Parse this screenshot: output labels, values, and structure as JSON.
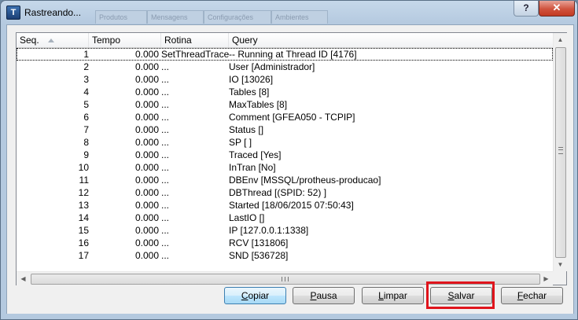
{
  "window": {
    "title": "Rastreando...",
    "help_label": "?",
    "close_label": "✕"
  },
  "ghost_tabs": [
    "Produtos",
    "Mensagens",
    "Configurações",
    "Ambientes"
  ],
  "columns": {
    "seq": "Seq.",
    "tempo": "Tempo",
    "rotina": "Rotina",
    "query": "Query"
  },
  "rows": [
    {
      "seq": "1",
      "tempo": "0.000",
      "rotina": "SetThreadTrace",
      "query": "-- Running at Thread ID [4176]"
    },
    {
      "seq": "2",
      "tempo": "0.000",
      "rotina": "...",
      "query": "User [Administrador]"
    },
    {
      "seq": "3",
      "tempo": "0.000",
      "rotina": "...",
      "query": "IO [13026]"
    },
    {
      "seq": "4",
      "tempo": "0.000",
      "rotina": "...",
      "query": "Tables [8]"
    },
    {
      "seq": "5",
      "tempo": "0.000",
      "rotina": "...",
      "query": "MaxTables [8]"
    },
    {
      "seq": "6",
      "tempo": "0.000",
      "rotina": "...",
      "query": "Comment [GFEA050 - TCPIP]"
    },
    {
      "seq": "7",
      "tempo": "0.000",
      "rotina": "...",
      "query": "Status []"
    },
    {
      "seq": "8",
      "tempo": "0.000",
      "rotina": "...",
      "query": "SP [ ]"
    },
    {
      "seq": "9",
      "tempo": "0.000",
      "rotina": "...",
      "query": "Traced [Yes]"
    },
    {
      "seq": "10",
      "tempo": "0.000",
      "rotina": "...",
      "query": "InTran [No]"
    },
    {
      "seq": "11",
      "tempo": "0.000",
      "rotina": "...",
      "query": "DBEnv [MSSQL/protheus-producao]"
    },
    {
      "seq": "12",
      "tempo": "0.000",
      "rotina": "...",
      "query": "DBThread [(SPID: 52) ]"
    },
    {
      "seq": "13",
      "tempo": "0.000",
      "rotina": "...",
      "query": "Started [18/06/2015 07:50:43]"
    },
    {
      "seq": "14",
      "tempo": "0.000",
      "rotina": "...",
      "query": "LastIO []"
    },
    {
      "seq": "15",
      "tempo": "0.000",
      "rotina": "...",
      "query": "IP [127.0.0.1:1338]"
    },
    {
      "seq": "16",
      "tempo": "0.000",
      "rotina": "...",
      "query": "RCV [131806]"
    },
    {
      "seq": "17",
      "tempo": "0.000",
      "rotina": "...",
      "query": "SND [536728]"
    }
  ],
  "buttons": {
    "copiar": {
      "mnemonic": "C",
      "rest": "opiar"
    },
    "pausa": {
      "mnemonic": "P",
      "rest": "ausa"
    },
    "limpar": {
      "mnemonic": "L",
      "rest": "impar"
    },
    "salvar": {
      "mnemonic": "S",
      "rest": "alvar"
    },
    "fechar": {
      "mnemonic": "F",
      "rest": "echar"
    }
  },
  "colors": {
    "highlight": "#e0141c",
    "window_frame": "#b4c9df",
    "close_button": "#c33a23"
  }
}
